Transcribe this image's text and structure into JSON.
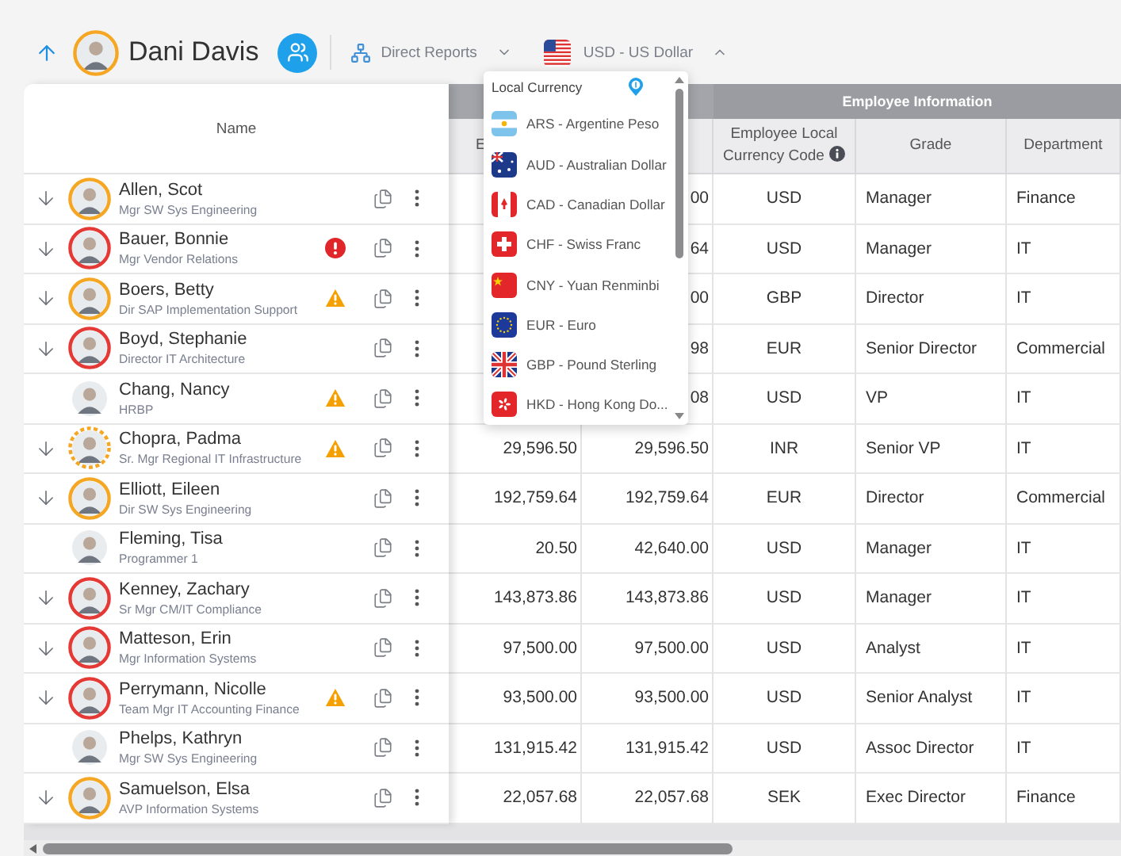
{
  "header": {
    "manager": {
      "name": "Dani Davis",
      "color": "#f5a623"
    },
    "view_selector": {
      "label": "Direct Reports",
      "expanded": false
    },
    "currency_selector": {
      "label": "USD - US Dollar",
      "kind": "us",
      "expanded": true
    }
  },
  "currency_dropdown": {
    "title": "Local Currency",
    "items": [
      {
        "label": "ARS - Argentine Peso",
        "kind": "ar"
      },
      {
        "label": "AUD - Australian Dollar",
        "kind": "au"
      },
      {
        "label": "CAD - Canadian Dollar",
        "kind": "ca"
      },
      {
        "label": "CHF - Swiss Franc",
        "kind": "ch"
      },
      {
        "label": "CNY - Yuan Renminbi",
        "kind": "cn"
      },
      {
        "label": "EUR - Euro",
        "kind": "eu"
      },
      {
        "label": "GBP - Pound Sterling",
        "kind": "gb"
      },
      {
        "label": "HKD - Hong Kong Do...",
        "kind": "hk"
      }
    ]
  },
  "table": {
    "name_header": "Name",
    "header_group": "Employee Information",
    "columns": [
      {
        "label": "E"
      },
      {},
      {
        "label": "Employee Local Currency Code",
        "info": true
      },
      {
        "label": "Grade"
      },
      {
        "label": "Department"
      }
    ],
    "rows": [
      {
        "name": "Allen, Scot",
        "title": "Mgr SW Sys Engineering",
        "expandable": true,
        "color": "#f5a623",
        "dashed": false,
        "error": false,
        "warning": false,
        "cells": [
          null,
          "00",
          "USD",
          "Manager",
          "Finance"
        ]
      },
      {
        "name": "Bauer, Bonnie",
        "title": "Mgr Vendor Relations",
        "expandable": true,
        "color": "#e53935",
        "dashed": false,
        "error": true,
        "warning": false,
        "cells": [
          null,
          "64",
          "USD",
          "Manager",
          "IT"
        ]
      },
      {
        "name": "Boers, Betty",
        "title": "Dir SAP Implementation Support",
        "expandable": true,
        "color": "#f5a623",
        "dashed": false,
        "error": false,
        "warning": true,
        "cells": [
          null,
          "00",
          "GBP",
          "Director",
          "IT"
        ]
      },
      {
        "name": "Boyd, Stephanie",
        "title": "Director IT Architecture",
        "expandable": true,
        "color": "#e53935",
        "dashed": false,
        "error": false,
        "warning": false,
        "cells": [
          null,
          "98",
          "EUR",
          "Senior Director",
          "Commercial"
        ]
      },
      {
        "name": "Chang, Nancy",
        "title": "HRBP",
        "expandable": false,
        "error": false,
        "warning": true,
        "cells": [
          null,
          "08",
          "USD",
          "VP",
          "IT"
        ]
      },
      {
        "name": "Chopra, Padma",
        "title": "Sr. Mgr Regional IT Infrastructure",
        "expandable": true,
        "color": "#f5a623",
        "dashed": true,
        "error": false,
        "warning": true,
        "cells": [
          "29,596.50",
          "29,596.50",
          "INR",
          "Senior VP",
          "IT"
        ]
      },
      {
        "name": "Elliott, Eileen",
        "title": "Dir SW Sys Engineering",
        "expandable": true,
        "color": "#f5a623",
        "dashed": false,
        "error": false,
        "warning": false,
        "cells": [
          "192,759.64",
          "192,759.64",
          "EUR",
          "Director",
          "Commercial"
        ]
      },
      {
        "name": "Fleming, Tisa",
        "title": "Programmer 1",
        "expandable": false,
        "error": false,
        "warning": false,
        "cells": [
          "20.50",
          "42,640.00",
          "USD",
          "Manager",
          "IT"
        ]
      },
      {
        "name": "Kenney, Zachary",
        "title": "Sr Mgr CM/IT Compliance",
        "expandable": true,
        "color": "#e53935",
        "dashed": false,
        "error": false,
        "warning": false,
        "cells": [
          "143,873.86",
          "143,873.86",
          "USD",
          "Manager",
          "IT"
        ]
      },
      {
        "name": "Matteson, Erin",
        "title": "Mgr Information Systems",
        "expandable": true,
        "color": "#e53935",
        "dashed": false,
        "error": false,
        "warning": false,
        "cells": [
          "97,500.00",
          "97,500.00",
          "USD",
          "Analyst",
          "IT"
        ]
      },
      {
        "name": "Perrymann, Nicolle",
        "title": "Team Mgr IT Accounting Finance",
        "expandable": true,
        "color": "#e53935",
        "dashed": false,
        "error": false,
        "warning": true,
        "cells": [
          "93,500.00",
          "93,500.00",
          "USD",
          "Senior Analyst",
          "IT"
        ]
      },
      {
        "name": "Phelps, Kathryn",
        "title": "Mgr SW Sys Engineering",
        "expandable": false,
        "error": false,
        "warning": false,
        "cells": [
          "131,915.42",
          "131,915.42",
          "USD",
          "Assoc Director",
          "IT"
        ]
      },
      {
        "name": "Samuelson, Elsa",
        "title": "AVP Information Systems",
        "expandable": true,
        "color": "#f5a623",
        "dashed": false,
        "error": false,
        "warning": false,
        "cells": [
          "22,057.68",
          "22,057.68",
          "SEK",
          "Exec Director",
          "Finance"
        ]
      }
    ]
  }
}
